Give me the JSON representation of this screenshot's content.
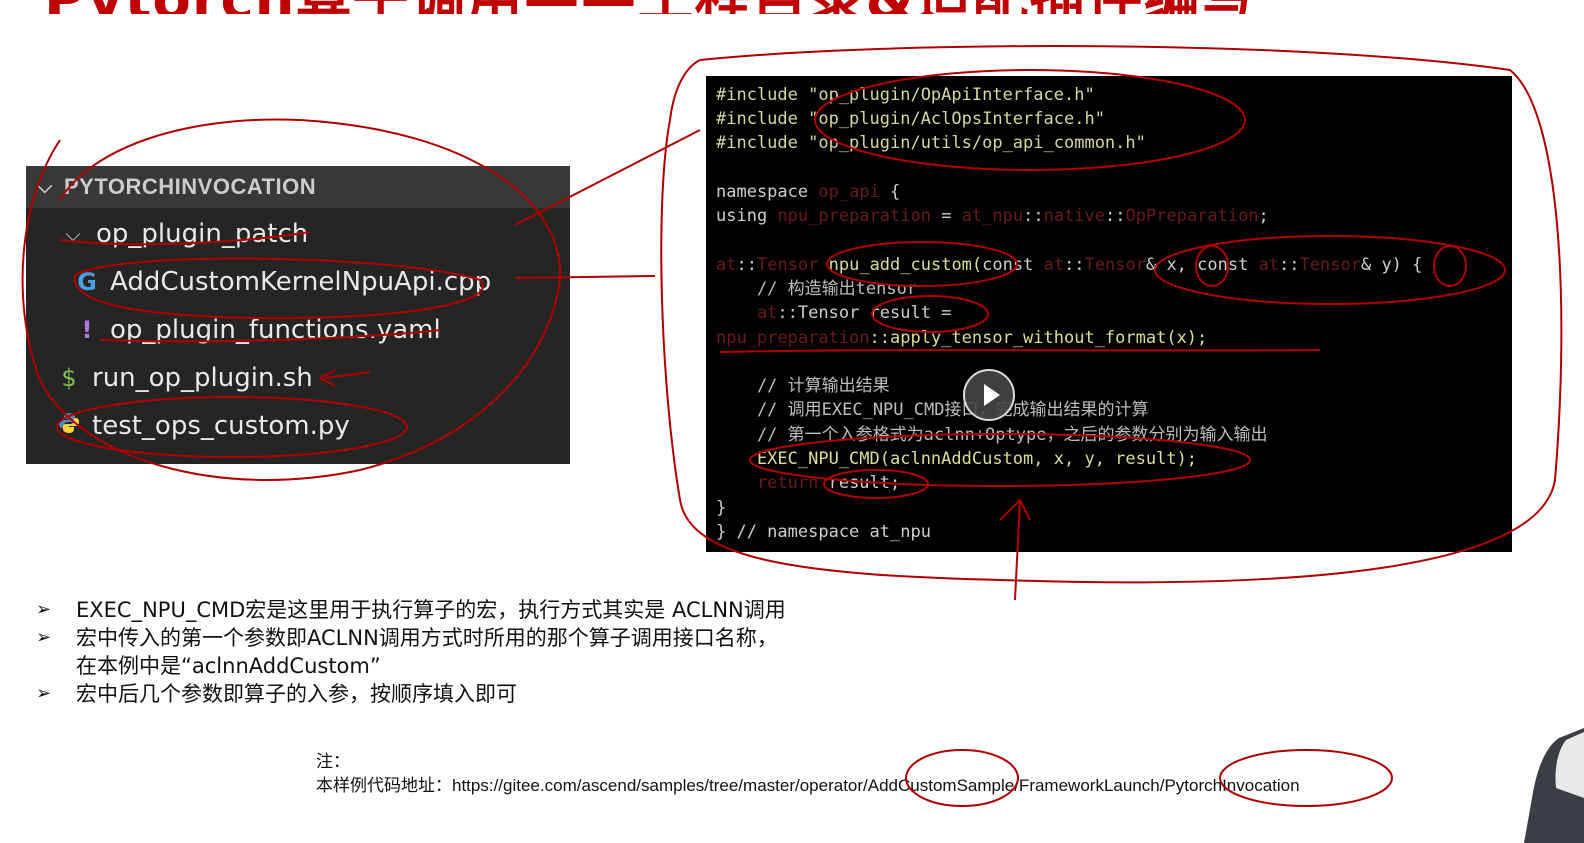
{
  "slide": {
    "title": "Pytorch算子调用——工程目录&适配插件编写"
  },
  "explorer": {
    "header": "PYTORCHINVOCATION",
    "items": [
      {
        "label": "op_plugin_patch",
        "icon": "chevron-down-icon"
      },
      {
        "label": "AddCustomKernelNpuApi.cpp",
        "icon": "cpp-file-icon"
      },
      {
        "label": "op_plugin_functions.yaml",
        "icon": "yaml-file-icon"
      },
      {
        "label": "run_op_plugin.sh",
        "icon": "shell-file-icon"
      },
      {
        "label": "test_ops_custom.py",
        "icon": "python-file-icon"
      }
    ]
  },
  "code": {
    "include1": "#include \"op_plugin/OpApiInterface.h\"",
    "include2": "#include \"op_plugin/AclOpsInterface.h\"",
    "include3": "#include \"op_plugin/utils/op_api_common.h\"",
    "ns_open_kw": "namespace ",
    "ns_open_name": "op_api",
    "ns_open_brace": " {",
    "using_kw": "using ",
    "using_name": "npu_preparation",
    "using_eq": " = ",
    "using_ns": "at_npu",
    "using_sep": "::",
    "using_native": "native",
    "using_sep2": "::",
    "using_type": "OpPreparation",
    "using_end": ";",
    "sig_at": "at",
    "sig_sep": "::",
    "sig_tensor": "Tensor",
    "sig_fn": " npu_add_custom(",
    "sig_const1": "const ",
    "sig_at2": "at",
    "sig_sep2": "::",
    "sig_tensor2": "Tensor",
    "sig_x": "& x, ",
    "sig_const2": "const ",
    "sig_at3": "at",
    "sig_sep3": "::",
    "sig_tensor3": "Tensor",
    "sig_y": "& y) {",
    "c1": "    // 构造输出tensor",
    "res_at": "    at",
    "res_rest": "::Tensor result =",
    "apply_prep": "npu_preparation",
    "apply_rest": "::apply_tensor_without_format(x);",
    "c2": "    // 计算输出结果",
    "c3": "    // 调用EXEC_NPU_CMD接口，完成输出结果的计算",
    "c4": "    // 第一个入参格式为aclnn+Optype，之后的参数分别为输入输出",
    "exec": "    EXEC_NPU_CMD(aclnnAddCustom, x, y, result);",
    "ret_kw": "    return",
    "ret_rest": " result;",
    "close1": "}",
    "close2": "} // namespace at_npu"
  },
  "bullets": [
    "EXEC_NPU_CMD宏是这里用于执行算子的宏，执行方式其实是 ACLNN调用",
    "宏中传入的第一个参数即ACLNN调用方式时所用的那个算子调用接口名称，在本例中是“aclnnAddCustom”",
    "宏中后几个参数即算子的入参，按顺序填入即可"
  ],
  "note": {
    "label": "注：",
    "prefix": "本样例代码地址：",
    "url": "https://gitee.com/ascend/samples/tree/master/operator/AddCustomSample/FrameworkLaunch/PytorchInvocation"
  },
  "colors": {
    "annotation_red": "#b00000",
    "title_red": "#c00000",
    "explorer_bg": "#252526",
    "code_bg": "#000000"
  }
}
